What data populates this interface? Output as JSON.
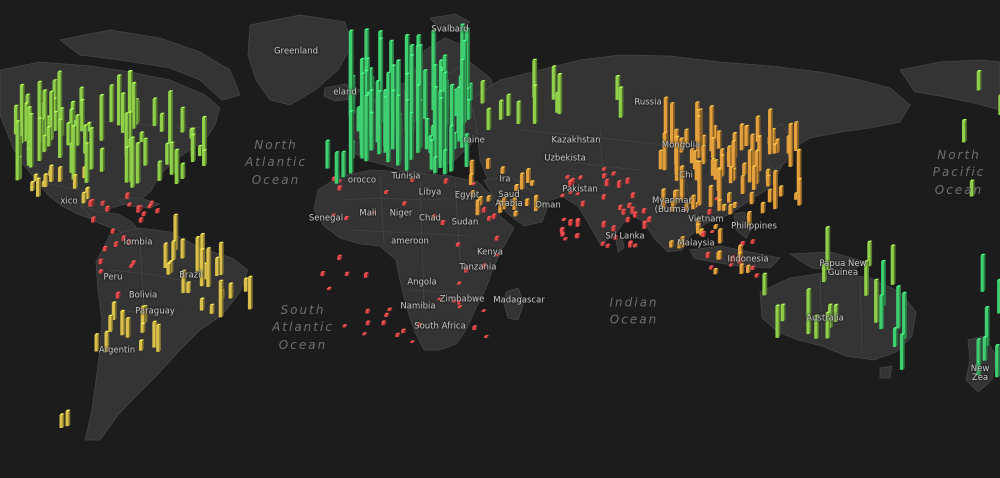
{
  "map": {
    "theme": "dark",
    "colors": {
      "background": "#1c1c1c",
      "land": "#343434",
      "bar_high": "#3fcf70",
      "bar_mid_high": "#8fcf4a",
      "bar_mid": "#d9c04a",
      "bar_mid_low": "#e3a03c",
      "bar_low": "#e04848"
    },
    "oceans": [
      {
        "id": "north-atlantic",
        "lines": [
          "North",
          "Atlantic",
          "Ocean"
        ]
      },
      {
        "id": "south-atlantic",
        "lines": [
          "South",
          "Atlantic",
          "Ocean"
        ]
      },
      {
        "id": "indian",
        "lines": [
          "Indian",
          "Ocean"
        ]
      },
      {
        "id": "north-pacific",
        "lines": [
          "North",
          "Pacific",
          "Ocean"
        ]
      }
    ],
    "countries": [
      {
        "id": "greenland",
        "label": "Greenland"
      },
      {
        "id": "svalbard",
        "label": "Svalbard"
      },
      {
        "id": "iceland",
        "label": "eland"
      },
      {
        "id": "russia",
        "label": "Russia"
      },
      {
        "id": "ukraine",
        "label": "raine"
      },
      {
        "id": "kazakhstan",
        "label": "Kazakhstan"
      },
      {
        "id": "mongolia",
        "label": "Mongolia"
      },
      {
        "id": "uzbekistan",
        "label": "Uzbekista"
      },
      {
        "id": "morocco",
        "label": "orocco"
      },
      {
        "id": "tunisia",
        "label": "Tunisia"
      },
      {
        "id": "libya",
        "label": "Libya"
      },
      {
        "id": "egypt",
        "label": "Egypt"
      },
      {
        "id": "iraq",
        "label": "Ira"
      },
      {
        "id": "saudi-arabia",
        "label": "Saud\nArabia"
      },
      {
        "id": "oman",
        "label": "Oman"
      },
      {
        "id": "pakistan",
        "label": "Pakistan"
      },
      {
        "id": "china",
        "label": "Chi"
      },
      {
        "id": "myanmar",
        "label": "Myanmar\n(Burma)"
      },
      {
        "id": "vietnam",
        "label": "Vietnam"
      },
      {
        "id": "philippines",
        "label": "Philippines"
      },
      {
        "id": "malaysia",
        "label": "Malaysia"
      },
      {
        "id": "sri-lanka",
        "label": "Sri Lanka"
      },
      {
        "id": "indonesia",
        "label": "Indonesia"
      },
      {
        "id": "papua-new-guinea",
        "label": "Papua New\nGuinea"
      },
      {
        "id": "australia",
        "label": "Australia"
      },
      {
        "id": "new-zealand",
        "label": "New\nZea"
      },
      {
        "id": "mali",
        "label": "Mali"
      },
      {
        "id": "niger",
        "label": "Niger"
      },
      {
        "id": "chad",
        "label": "Chad"
      },
      {
        "id": "sudan",
        "label": "Sudan"
      },
      {
        "id": "senegal",
        "label": "Senegal"
      },
      {
        "id": "cameroon",
        "label": "ameroon"
      },
      {
        "id": "kenya",
        "label": "Kenya"
      },
      {
        "id": "tanzania",
        "label": "Tanzania"
      },
      {
        "id": "angola",
        "label": "Angola"
      },
      {
        "id": "zimbabwe",
        "label": "Zimbabwe"
      },
      {
        "id": "namibia",
        "label": "Namibia"
      },
      {
        "id": "madagascar",
        "label": "Madagascar"
      },
      {
        "id": "south-africa",
        "label": "South Africa"
      },
      {
        "id": "mexico",
        "label": "xico"
      },
      {
        "id": "colombia",
        "label": "lombia"
      },
      {
        "id": "peru",
        "label": "Peru"
      },
      {
        "id": "brazil",
        "label": "Brazil"
      },
      {
        "id": "bolivia",
        "label": "Bolivia"
      },
      {
        "id": "paraguay",
        "label": "Paraguay"
      },
      {
        "id": "argentina",
        "label": "Argentin"
      }
    ]
  }
}
